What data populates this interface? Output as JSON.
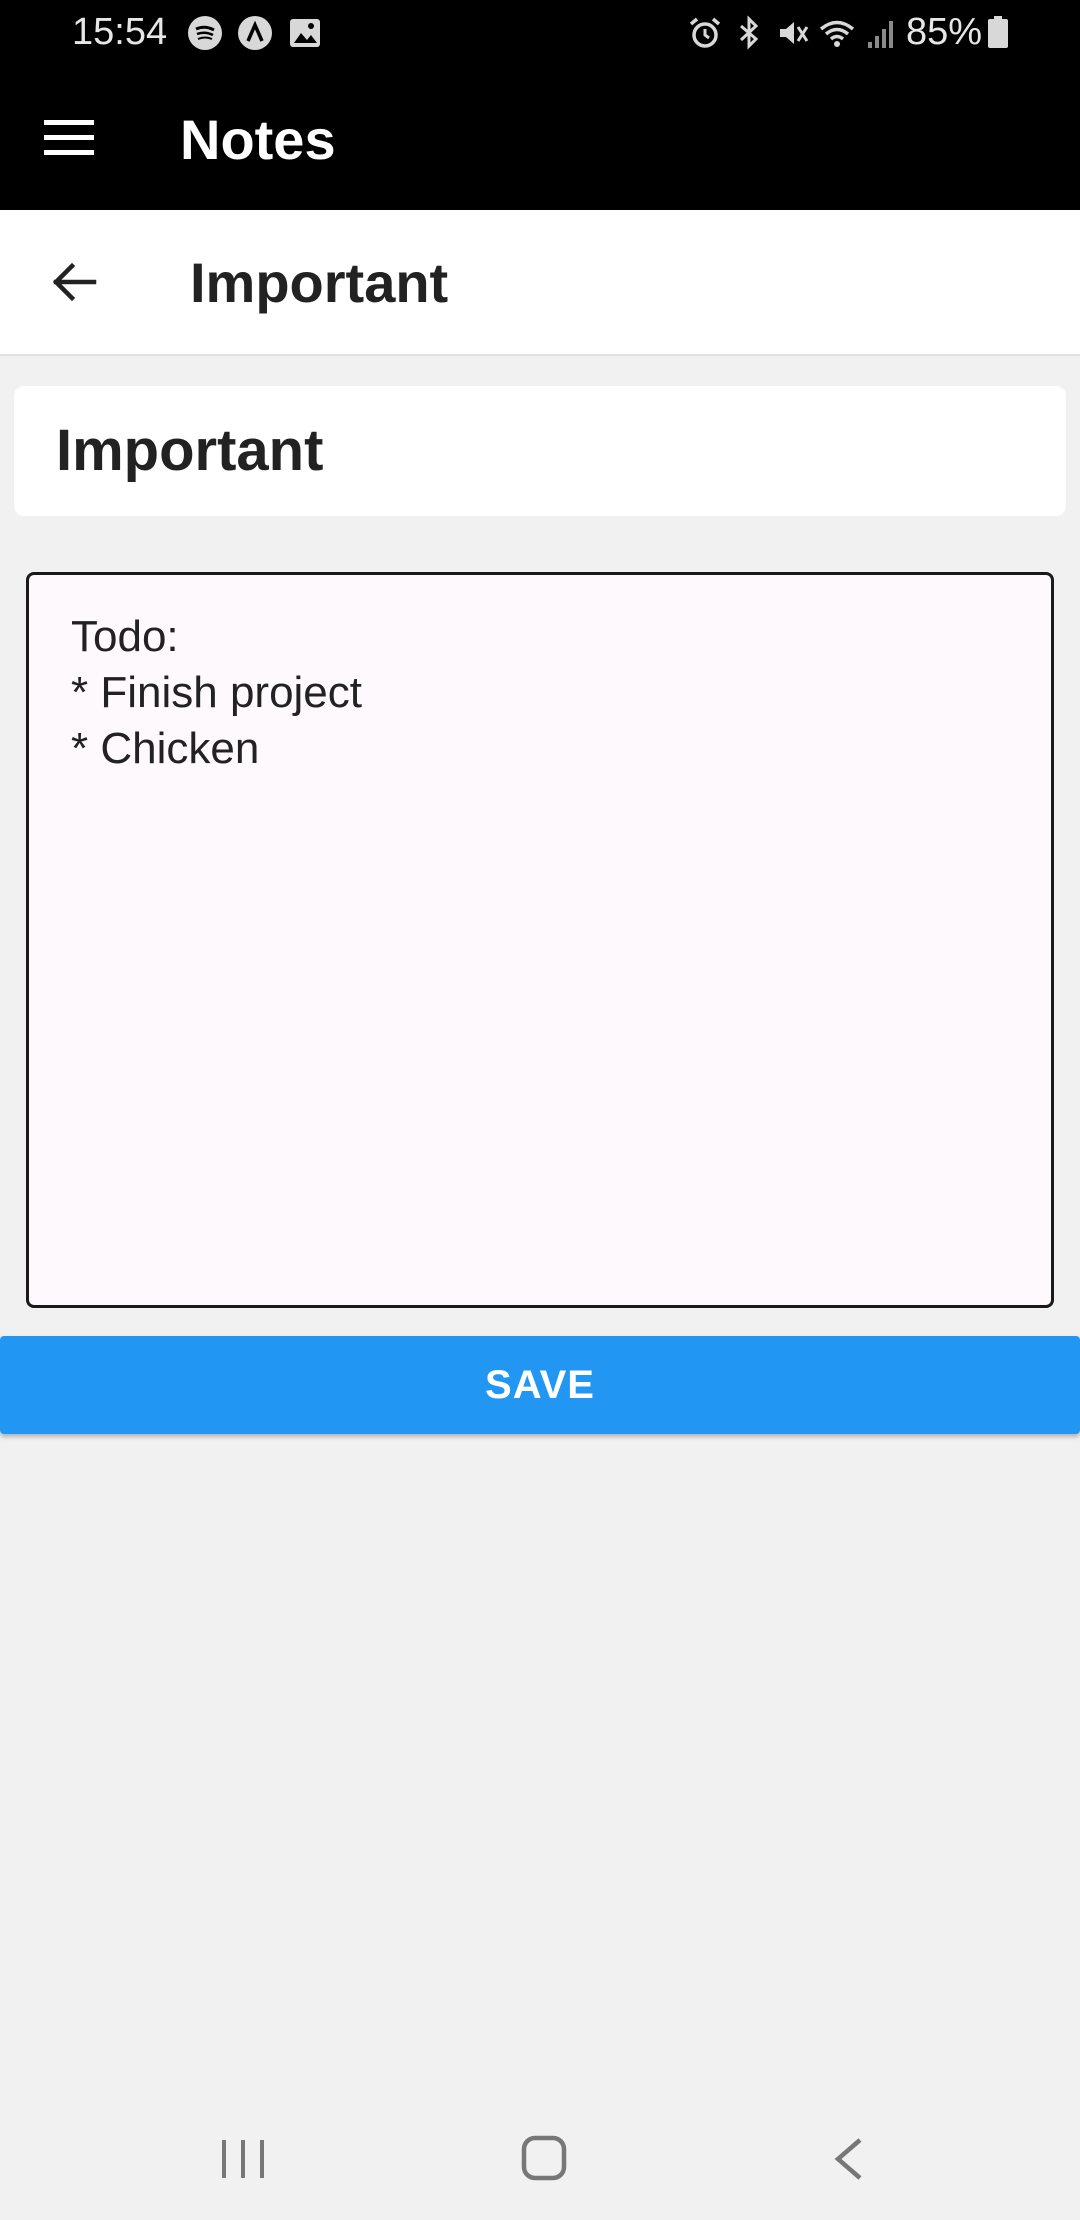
{
  "status_bar": {
    "time": "15:54",
    "battery": "85%",
    "icons_left": [
      "spotify-icon",
      "app-icon",
      "gallery-icon"
    ],
    "icons_right": [
      "alarm-icon",
      "bluetooth-icon",
      "mute-icon",
      "wifi-icon",
      "signal-icon",
      "battery-icon"
    ]
  },
  "app_bar": {
    "title": "Notes"
  },
  "header": {
    "title": "Important"
  },
  "note": {
    "title": "Important",
    "body_lines": [
      "Todo:",
      "* Finish project",
      "* Chicken"
    ]
  },
  "actions": {
    "save_label": "SAVE"
  },
  "colors": {
    "app_bar": "#000000",
    "save_button": "#2196F3",
    "background": "#F1F1F1"
  }
}
